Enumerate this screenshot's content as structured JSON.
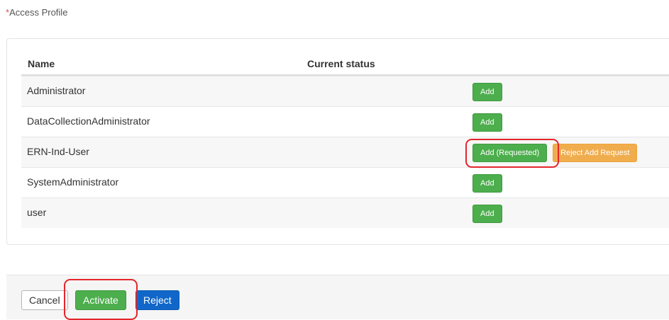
{
  "header": {
    "required_marker": "*",
    "label": "Access Profile"
  },
  "table": {
    "columns": [
      "Name",
      "Current status"
    ],
    "rows": [
      {
        "name": "Administrator",
        "buttons": [
          "Add"
        ]
      },
      {
        "name": "DataCollectionAdministrator",
        "buttons": [
          "Add"
        ]
      },
      {
        "name": "ERN-Ind-User",
        "buttons": [
          "Add (Requested)",
          "Reject Add Request"
        ]
      },
      {
        "name": "SystemAdministrator",
        "buttons": [
          "Add"
        ]
      },
      {
        "name": "user",
        "buttons": [
          "Add"
        ]
      }
    ]
  },
  "footer": {
    "cancel_label": "Cancel",
    "activate_label": "Activate",
    "reject_label": "Reject"
  },
  "colors": {
    "add_button": "#4cae4c",
    "reject_request_button": "#f0ad4e",
    "reject_button": "#1167c9",
    "highlight_outline": "#e3262b"
  }
}
